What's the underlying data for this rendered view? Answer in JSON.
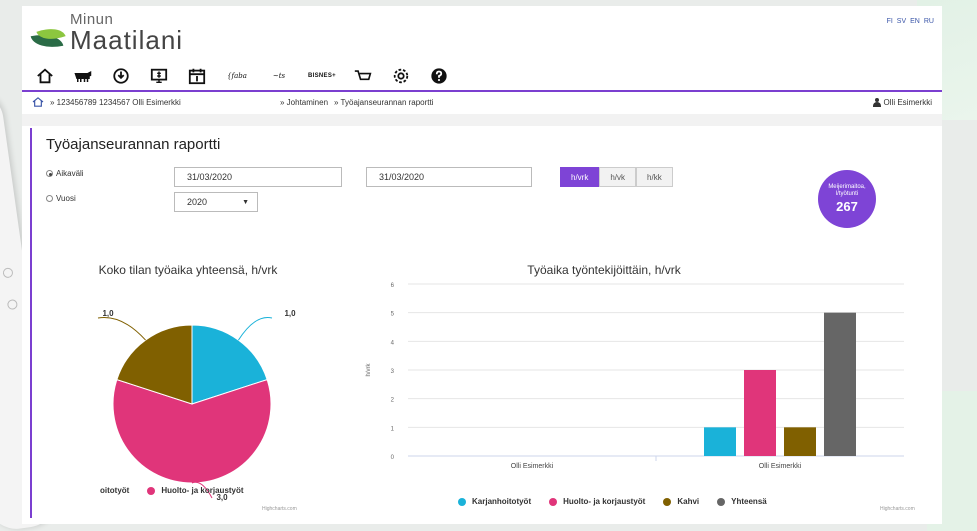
{
  "header": {
    "logo_small": "Minun",
    "logo_big": "Maatilani",
    "languages": [
      "FI",
      "SV",
      "EN",
      "RU"
    ],
    "toolbar_icons": [
      {
        "name": "home-icon",
        "glyph": "⌂"
      },
      {
        "name": "cow-icon",
        "glyph": ""
      },
      {
        "name": "power-icon",
        "glyph": ""
      },
      {
        "name": "money-icon",
        "glyph": ""
      },
      {
        "name": "calendar-icon",
        "glyph": ""
      },
      {
        "name": "faba-logo-icon",
        "text": "{faba"
      },
      {
        "name": "vet-logo-icon",
        "text": "~ts"
      },
      {
        "name": "business-icon",
        "text": "BISNES+"
      },
      {
        "name": "cart-icon",
        "glyph": ""
      },
      {
        "name": "settings-icon",
        "glyph": "⚙"
      },
      {
        "name": "help-icon",
        "glyph": ""
      }
    ]
  },
  "breadcrumb": {
    "farm": "» 123456789 1234567 Olli Esimerkki",
    "section": "» Johtaminen",
    "page": "» Työajanseurannan raportti",
    "user": "Olli Esimerkki"
  },
  "report": {
    "title": "Työajanseurannan raportti",
    "period_label": "Aikaväli",
    "year_label": "Vuosi",
    "start_date": "31/03/2020",
    "end_date": "31/03/2020",
    "year_value": "2020",
    "units": [
      "h/vrk",
      "h/vk",
      "h/kk"
    ],
    "active_unit": "h/vrk",
    "kpi_label": "Meijerimaitoa, l/työtunti",
    "kpi_value": "267"
  },
  "colors": {
    "accent": "#7e44d6",
    "karjanhoito": "#1ab2d9",
    "huolto": "#e0357a",
    "kahvi": "#806000",
    "yhteensa": "#666666"
  },
  "chart_data": [
    {
      "type": "pie",
      "title": "Koko tilan työaika yhteensä, h/vrk",
      "slices": [
        {
          "name": "Karjanhoitotyöt",
          "value": 1.0,
          "label": "1,0"
        },
        {
          "name": "Huolto- ja korjaustyöt",
          "value": 3.0,
          "label": "3,0"
        },
        {
          "name": "Kahvi",
          "value": 1.0,
          "label": "1,0"
        }
      ],
      "legend": [
        "oitotyöt",
        "Huolto- ja korjaustyöt"
      ],
      "credits": "Highcharts.com"
    },
    {
      "type": "bar",
      "title": "Työaika työntekijöittäin, h/vrk",
      "ylabel": "h/vrk",
      "ylim": [
        0,
        6
      ],
      "yticks": [
        "0",
        "1",
        "2",
        "3",
        "4",
        "5",
        "6"
      ],
      "categories": [
        "Olli Esimerkki",
        "Olli Esimerkki"
      ],
      "series": [
        {
          "name": "Karjanhoitotyöt",
          "values": [
            0,
            1
          ]
        },
        {
          "name": "Huolto- ja korjaustyöt",
          "values": [
            0,
            3
          ]
        },
        {
          "name": "Kahvi",
          "values": [
            0,
            1
          ]
        },
        {
          "name": "Yhteensä",
          "values": [
            0,
            5
          ]
        }
      ],
      "credits": "Highcharts.com"
    }
  ]
}
